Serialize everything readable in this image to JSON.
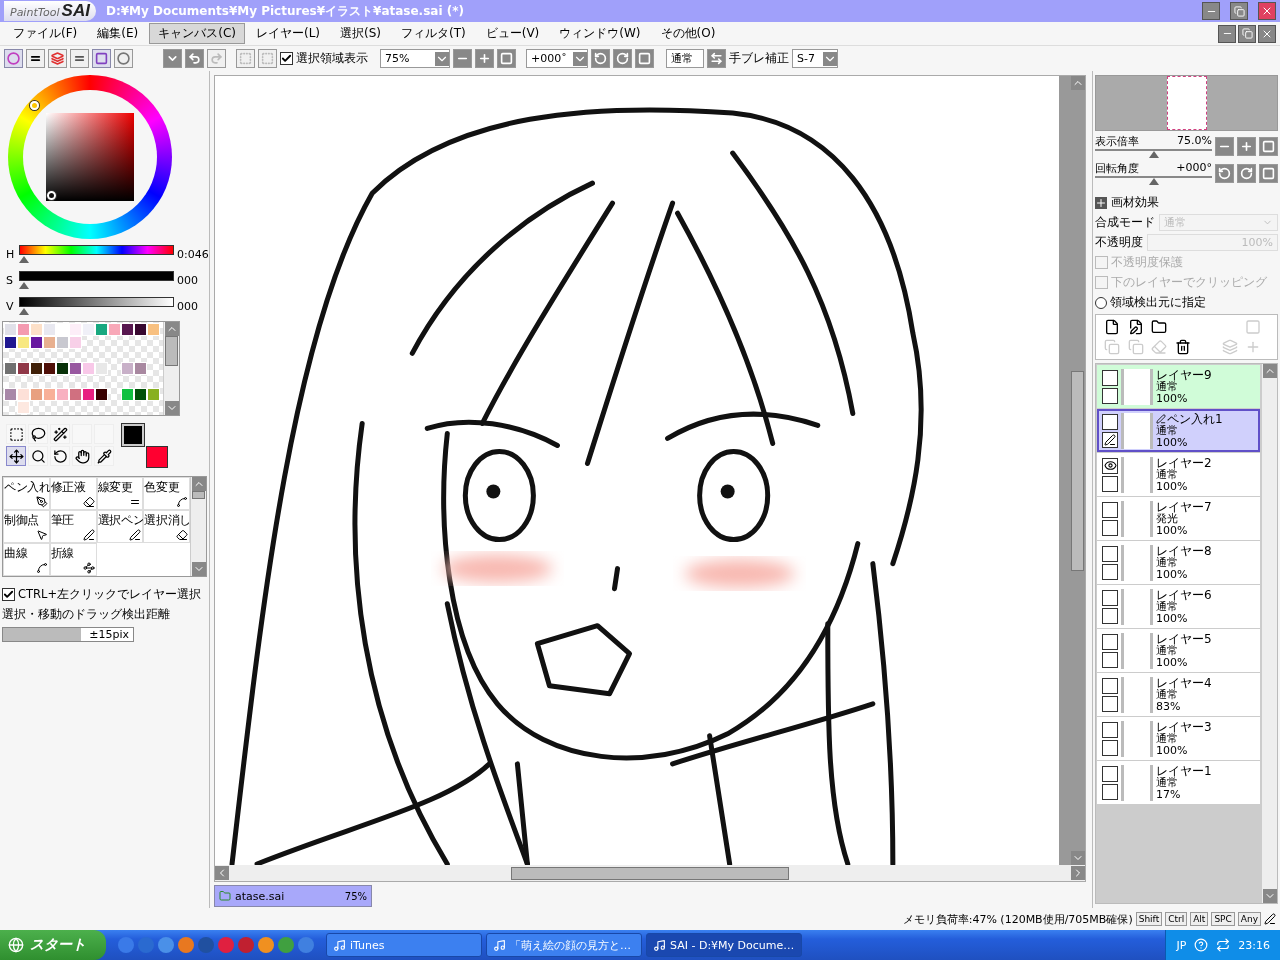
{
  "window": {
    "logo_small": "PaintTool",
    "logo_large": "SAI",
    "title": "D:¥My Documents¥My Pictures¥イラスト¥atase.sai (*)"
  },
  "menu": [
    {
      "label": "ファイル(F)",
      "selected": false
    },
    {
      "label": "編集(E)",
      "selected": false
    },
    {
      "label": "キャンバス(C)",
      "selected": true
    },
    {
      "label": "レイヤー(L)",
      "selected": false
    },
    {
      "label": "選択(S)",
      "selected": false
    },
    {
      "label": "フィルタ(T)",
      "selected": false
    },
    {
      "label": "ビュー(V)",
      "selected": false
    },
    {
      "label": "ウィンドウ(W)",
      "selected": false
    },
    {
      "label": "その他(O)",
      "selected": false
    }
  ],
  "toolbar": {
    "show_selection": {
      "label": "選択領域表示",
      "checked": true
    },
    "zoom": "75%",
    "rotation": "+000˚",
    "blend": "通常",
    "stabilizer_label": "手ブレ補正",
    "stabilizer": "S-7"
  },
  "color_sliders": [
    {
      "label": "H",
      "level": 0.0,
      "reading": "0:046"
    },
    {
      "label": "S",
      "level": 0.0,
      "reading": "000"
    },
    {
      "label": "V",
      "level": 0.0,
      "reading": "000"
    }
  ],
  "palette": [
    {
      "cells": [
        {
          "kind": "swatch",
          "color": "#e0e0e8"
        },
        {
          "kind": "swatch",
          "color": "#f49ab0"
        },
        {
          "kind": "swatch",
          "color": "#fde0c8"
        },
        {
          "kind": "swatch",
          "color": "#e8e8f0"
        },
        {
          "kind": "swatch",
          "color": "#ffffff"
        },
        {
          "kind": "swatch",
          "color": "#fdeef8"
        },
        {
          "kind": "swatch",
          "color": "#f0f0f8"
        },
        {
          "kind": "swatch",
          "color": "#18a880"
        },
        {
          "kind": "swatch",
          "color": "#f8a8b8"
        },
        {
          "kind": "swatch",
          "color": "#581850"
        },
        {
          "kind": "swatch",
          "color": "#380830"
        },
        {
          "kind": "swatch",
          "color": "#f8c080"
        }
      ]
    },
    {
      "cells": [
        {
          "kind": "swatch",
          "color": "#201890"
        },
        {
          "kind": "swatch",
          "color": "#f8e880"
        },
        {
          "kind": "swatch",
          "color": "#6818a0"
        },
        {
          "kind": "swatch",
          "color": "#e8b090"
        },
        {
          "kind": "swatch",
          "color": "#c8c8d0"
        },
        {
          "kind": "swatch",
          "color": "#f8d0e8"
        },
        {
          "kind": "empty"
        },
        {
          "kind": "empty"
        },
        {
          "kind": "empty"
        },
        {
          "kind": "empty"
        },
        {
          "kind": "empty"
        },
        {
          "kind": "empty"
        }
      ]
    },
    {
      "cells": [
        {
          "kind": "empty"
        },
        {
          "kind": "empty"
        },
        {
          "kind": "empty"
        },
        {
          "kind": "empty"
        },
        {
          "kind": "empty"
        },
        {
          "kind": "empty"
        },
        {
          "kind": "empty"
        },
        {
          "kind": "empty"
        },
        {
          "kind": "empty"
        },
        {
          "kind": "empty"
        },
        {
          "kind": "empty"
        },
        {
          "kind": "empty"
        }
      ]
    },
    {
      "cells": [
        {
          "kind": "swatch",
          "color": "#707070"
        },
        {
          "kind": "swatch",
          "color": "#903848"
        },
        {
          "kind": "swatch",
          "color": "#402008"
        },
        {
          "kind": "swatch",
          "color": "#501008"
        },
        {
          "kind": "swatch",
          "color": "#083008"
        },
        {
          "kind": "swatch",
          "color": "#9858a0"
        },
        {
          "kind": "swatch",
          "color": "#f8c8e8"
        },
        {
          "kind": "swatch",
          "color": "#e8e8e8"
        },
        {
          "kind": "empty"
        },
        {
          "kind": "swatch",
          "color": "#c8b0c8"
        },
        {
          "kind": "swatch",
          "color": "#a888a0"
        },
        {
          "kind": "empty"
        }
      ]
    },
    {
      "cells": [
        {
          "kind": "empty"
        },
        {
          "kind": "empty"
        },
        {
          "kind": "empty"
        },
        {
          "kind": "empty"
        },
        {
          "kind": "empty"
        },
        {
          "kind": "empty"
        },
        {
          "kind": "empty"
        },
        {
          "kind": "empty"
        },
        {
          "kind": "empty"
        },
        {
          "kind": "empty"
        },
        {
          "kind": "empty"
        },
        {
          "kind": "empty"
        }
      ]
    },
    {
      "cells": [
        {
          "kind": "swatch",
          "color": "#a888a8"
        },
        {
          "kind": "swatch",
          "color": "#fde0d8"
        },
        {
          "kind": "swatch",
          "color": "#e8a080"
        },
        {
          "kind": "swatch",
          "color": "#f8b098"
        },
        {
          "kind": "swatch",
          "color": "#f8b0c0"
        },
        {
          "kind": "swatch",
          "color": "#d07080"
        },
        {
          "kind": "swatch",
          "color": "#e82080"
        },
        {
          "kind": "swatch",
          "color": "#380000"
        },
        {
          "kind": "empty"
        },
        {
          "kind": "swatch",
          "color": "#10c040"
        },
        {
          "kind": "swatch",
          "color": "#005008"
        },
        {
          "kind": "swatch",
          "color": "#88b020"
        }
      ]
    },
    {
      "cells": [
        {
          "kind": "empty"
        },
        {
          "kind": "swatch",
          "color": "#fde8e0"
        },
        {
          "kind": "empty"
        },
        {
          "kind": "empty"
        },
        {
          "kind": "empty"
        },
        {
          "kind": "empty"
        },
        {
          "kind": "empty"
        },
        {
          "kind": "empty"
        },
        {
          "kind": "empty"
        },
        {
          "kind": "empty"
        },
        {
          "kind": "empty"
        },
        {
          "kind": "empty"
        }
      ]
    }
  ],
  "tools": [
    {
      "kind": "rect-select",
      "selected": false
    },
    {
      "kind": "lasso",
      "selected": false
    },
    {
      "kind": "wand",
      "selected": false
    },
    {
      "kind": "blank",
      "selected": false
    },
    {
      "kind": "blank",
      "selected": false
    },
    {
      "kind": "move",
      "selected": true
    },
    {
      "kind": "zoom",
      "selected": false
    },
    {
      "kind": "rotate",
      "selected": false
    },
    {
      "kind": "hand",
      "selected": false
    },
    {
      "kind": "eyedropper",
      "selected": false
    }
  ],
  "main_color": {
    "color": "#000000"
  },
  "sub_color": {
    "color": "#ff0030"
  },
  "brushes": [
    {
      "label": "ペン入れ",
      "kind": "pen",
      "selected": false
    },
    {
      "label": "修正液",
      "kind": "eraser",
      "selected": false
    },
    {
      "label": "線変更",
      "kind": "lines",
      "selected": false
    },
    {
      "label": "色変更",
      "kind": "curve",
      "selected": false
    },
    {
      "label": "制御点",
      "kind": "pointer",
      "selected": false
    },
    {
      "label": "筆圧",
      "kind": "pressure",
      "selected": false
    },
    {
      "label": "選択ペン",
      "kind": "select-pen",
      "selected": false
    },
    {
      "label": "選択消し",
      "kind": "select-erase",
      "selected": false
    },
    {
      "label": "曲線",
      "kind": "curve",
      "selected": false
    },
    {
      "label": "折線",
      "kind": "polyline",
      "selected": false
    }
  ],
  "ctrl_click": {
    "label": "CTRL+左クリックでレイヤー選択",
    "checked": true
  },
  "drag_distance": {
    "label": "選択・移動のドラッグ検出距離",
    "level": 0.6,
    "reading": "±15pix"
  },
  "navigator": {
    "zoom": {
      "label": "表示倍率",
      "reading": "75.0%",
      "level": 0.5
    },
    "rotation": {
      "label": "回転角度",
      "reading": "+000°",
      "level": 0.5
    }
  },
  "layer_props": {
    "effects": "画材効果",
    "blend_label": "合成モード",
    "blend": "通常",
    "opacity_label": "不透明度",
    "opacity": "100%",
    "protect": {
      "label": "不透明度保護",
      "checked": false,
      "disabled": true
    },
    "clip": {
      "label": "下のレイヤーでクリッピング",
      "checked": false,
      "disabled": true
    },
    "source": {
      "label": "領域検出元に指定",
      "checked": false
    }
  },
  "layers": [
    {
      "name": "レイヤー9",
      "mode": "通常",
      "opacity": "100%",
      "color": "#d0fcd8",
      "selected": false,
      "visible": false,
      "pen": false
    },
    {
      "name": "ペン入れ1",
      "mode": "通常",
      "opacity": "100%",
      "color": "#d0d0fc",
      "selected": true,
      "visible": false,
      "pen": true
    },
    {
      "name": "レイヤー2",
      "mode": "通常",
      "opacity": "100%",
      "color": "#ffffff",
      "selected": false,
      "visible": true,
      "pen": false
    },
    {
      "name": "レイヤー7",
      "mode": "発光",
      "opacity": "100%",
      "color": "#ffffff",
      "selected": false,
      "visible": false,
      "pen": false
    },
    {
      "name": "レイヤー8",
      "mode": "通常",
      "opacity": "100%",
      "color": "#ffffff",
      "selected": false,
      "visible": false,
      "pen": false
    },
    {
      "name": "レイヤー6",
      "mode": "通常",
      "opacity": "100%",
      "color": "#ffffff",
      "selected": false,
      "visible": false,
      "pen": false
    },
    {
      "name": "レイヤー5",
      "mode": "通常",
      "opacity": "100%",
      "color": "#ffffff",
      "selected": false,
      "visible": false,
      "pen": false
    },
    {
      "name": "レイヤー4",
      "mode": "通常",
      "opacity": "83%",
      "color": "#ffffff",
      "selected": false,
      "visible": false,
      "pen": false
    },
    {
      "name": "レイヤー3",
      "mode": "通常",
      "opacity": "100%",
      "color": "#ffffff",
      "selected": false,
      "visible": false,
      "pen": false
    },
    {
      "name": "レイヤー1",
      "mode": "通常",
      "opacity": "17%",
      "color": "#ffffff",
      "selected": false,
      "visible": false,
      "pen": false
    }
  ],
  "document_tab": {
    "name": "atase.sai",
    "zoom": "75%",
    "selected": true
  },
  "status": {
    "memory": "メモリ負荷率:47% (120MB使用/705MB確保)",
    "keys": [
      "Shift",
      "Ctrl",
      "Alt",
      "SPC",
      "Any"
    ]
  },
  "taskbar": {
    "start": "スタート",
    "tasks": [
      {
        "label": "iTunes",
        "selected": false
      },
      {
        "label": "「萌え絵の顔の見方と…",
        "selected": false
      },
      {
        "label": "SAI - D:¥My Docume…",
        "selected": true
      }
    ],
    "language": "JP",
    "clock": "23:16"
  }
}
